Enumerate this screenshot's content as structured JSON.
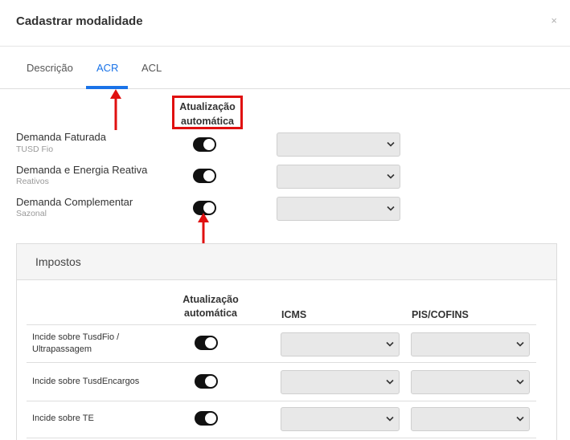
{
  "modal": {
    "title": "Cadastrar modalidade",
    "close_symbol": "×"
  },
  "tabs": [
    {
      "label": "Descrição",
      "active": false
    },
    {
      "label": "ACR",
      "active": true
    },
    {
      "label": "ACL",
      "active": false
    }
  ],
  "acr": {
    "column_header_line1": "Atualização",
    "column_header_line2": "automática",
    "rows": [
      {
        "label": "Demanda Faturada",
        "sublabel": "TUSD Fio",
        "auto_update": true
      },
      {
        "label": "Demanda e Energia Reativa",
        "sublabel": "Reativos",
        "auto_update": true
      },
      {
        "label": "Demanda Complementar",
        "sublabel": "Sazonal",
        "auto_update": true
      }
    ]
  },
  "impostos": {
    "title": "Impostos",
    "headers": {
      "auto_line1": "Atualização",
      "auto_line2": "automática",
      "icms": "ICMS",
      "pis_cofins": "PIS/COFINS"
    },
    "rows": [
      {
        "label_line1": "Incide sobre TusdFio /",
        "label_line2": "Ultrapassagem",
        "auto_update": true
      },
      {
        "label_line1": "Incide sobre TusdEncargos",
        "label_line2": "",
        "auto_update": true
      },
      {
        "label_line1": "Incide sobre TE",
        "label_line2": "",
        "auto_update": true
      }
    ]
  },
  "colors": {
    "accent": "#1a73e8",
    "annotation": "#e01010",
    "toggle_on": "#111111"
  }
}
